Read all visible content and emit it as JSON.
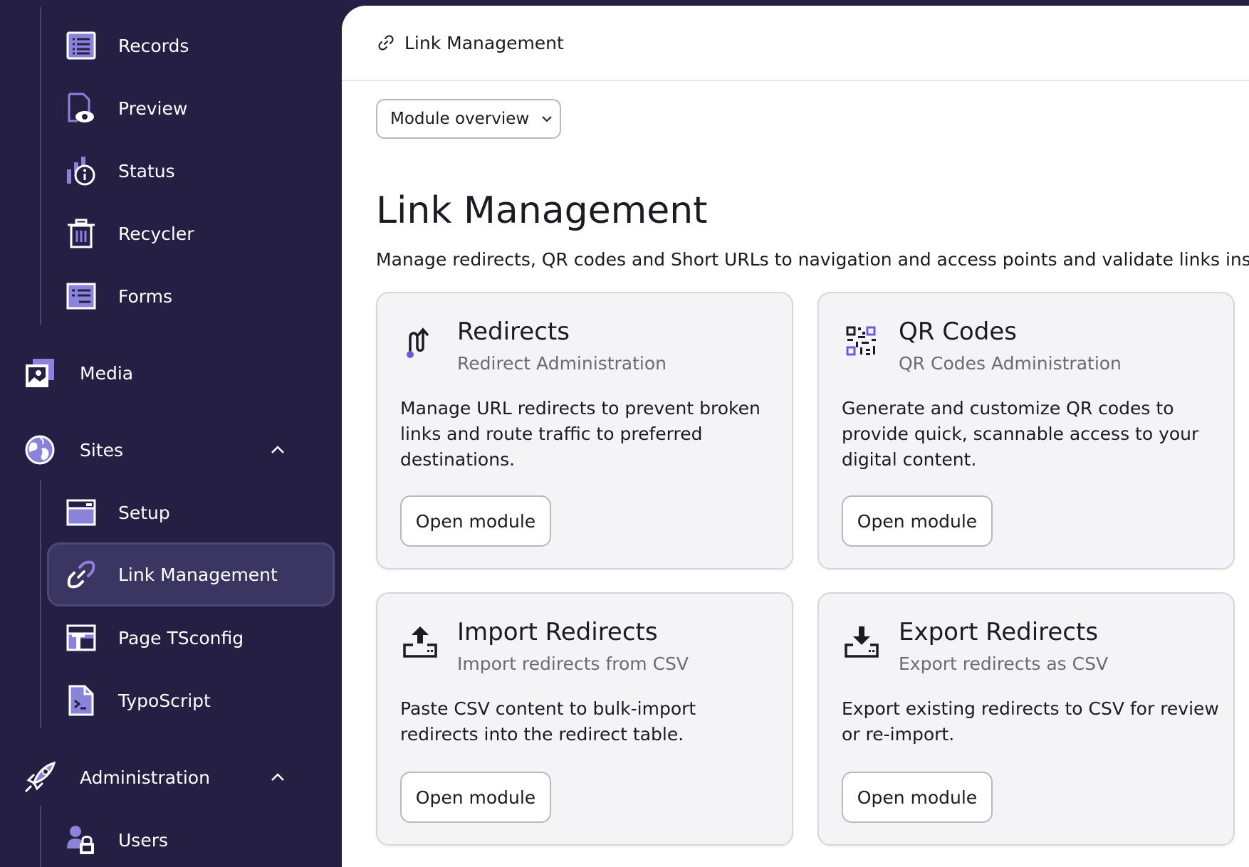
{
  "sidebar": {
    "items": [
      {
        "label": "Records",
        "icon": "records-icon"
      },
      {
        "label": "Preview",
        "icon": "preview-icon"
      },
      {
        "label": "Status",
        "icon": "status-icon"
      },
      {
        "label": "Recycler",
        "icon": "recycler-icon"
      },
      {
        "label": "Forms",
        "icon": "forms-icon"
      },
      {
        "label": "Media",
        "icon": "media-icon"
      },
      {
        "label": "Sites",
        "icon": "sites-icon",
        "expanded": true
      },
      {
        "label": "Setup",
        "icon": "setup-icon"
      },
      {
        "label": "Link Management",
        "icon": "link-icon",
        "active": true
      },
      {
        "label": "Page TSconfig",
        "icon": "page-tsconfig-icon"
      },
      {
        "label": "TypoScript",
        "icon": "typoscript-icon"
      },
      {
        "label": "Administration",
        "icon": "administration-icon",
        "expanded": true
      },
      {
        "label": "Users",
        "icon": "users-icon"
      }
    ]
  },
  "header": {
    "breadcrumb": "Link Management",
    "breadcrumb_icon": "link-icon"
  },
  "module_select": {
    "value": "Module overview"
  },
  "page": {
    "title": "Link Management",
    "description": "Manage redirects, QR codes and Short URLs to navigation and access points and validate links inside"
  },
  "cards": [
    {
      "title": "Redirects",
      "subtitle": "Redirect Administration",
      "text": "Manage URL redirects to prevent broken links and route traffic to preferred destinations.",
      "button": "Open module",
      "icon": "redirects-icon"
    },
    {
      "title": "QR Codes",
      "subtitle": "QR Codes Administration",
      "text": "Generate and customize QR codes to provide quick, scannable access to your digital content.",
      "button": "Open module",
      "icon": "qr-code-icon"
    },
    {
      "title": "Import Redirects",
      "subtitle": "Import redirects from CSV",
      "text": "Paste CSV content to bulk-import redirects into the redirect table.",
      "button": "Open module",
      "icon": "import-icon"
    },
    {
      "title": "Export Redirects",
      "subtitle": "Export redirects as CSV",
      "text": "Export existing redirects to CSV for review or re-import.",
      "button": "Open module",
      "icon": "export-icon"
    }
  ],
  "colors": {
    "sidebar_bg": "#241f43",
    "accent": "#7c6fd6",
    "active_item_bg": "#3a3561"
  }
}
